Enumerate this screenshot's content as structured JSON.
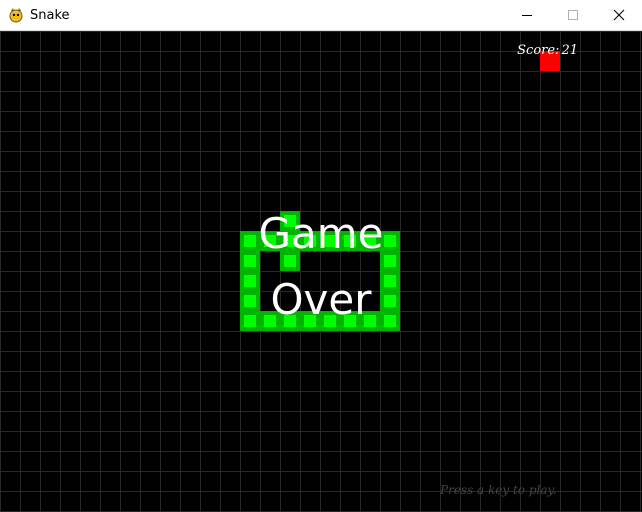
{
  "window": {
    "title": "Snake",
    "icon": "pygame-snake-icon",
    "controls": [
      "minimize-icon",
      "maximize-icon",
      "close-icon"
    ]
  },
  "hud": {
    "score_label": "Score:",
    "score_value": "21"
  },
  "overlay": {
    "line1": "Game",
    "line2": "Over",
    "prompt": "Press a key to play."
  },
  "board": {
    "columns": 32,
    "rows": 24,
    "background": "#000000",
    "grid_color": "#282828"
  },
  "colors": {
    "snake_outer": "#00b400",
    "snake_inner": "#00ff00",
    "apple": "#ff0000"
  },
  "apple": {
    "col": 27,
    "row": 1
  },
  "snake": [
    [
      14,
      9
    ],
    [
      12,
      10
    ],
    [
      13,
      10
    ],
    [
      14,
      10
    ],
    [
      15,
      10
    ],
    [
      16,
      10
    ],
    [
      17,
      10
    ],
    [
      18,
      10
    ],
    [
      19,
      10
    ],
    [
      12,
      11
    ],
    [
      14,
      11
    ],
    [
      19,
      11
    ],
    [
      12,
      12
    ],
    [
      19,
      12
    ],
    [
      12,
      13
    ],
    [
      19,
      13
    ],
    [
      12,
      14
    ],
    [
      13,
      14
    ],
    [
      14,
      14
    ],
    [
      15,
      14
    ],
    [
      16,
      14
    ],
    [
      17,
      14
    ],
    [
      18,
      14
    ],
    [
      19,
      14
    ]
  ]
}
